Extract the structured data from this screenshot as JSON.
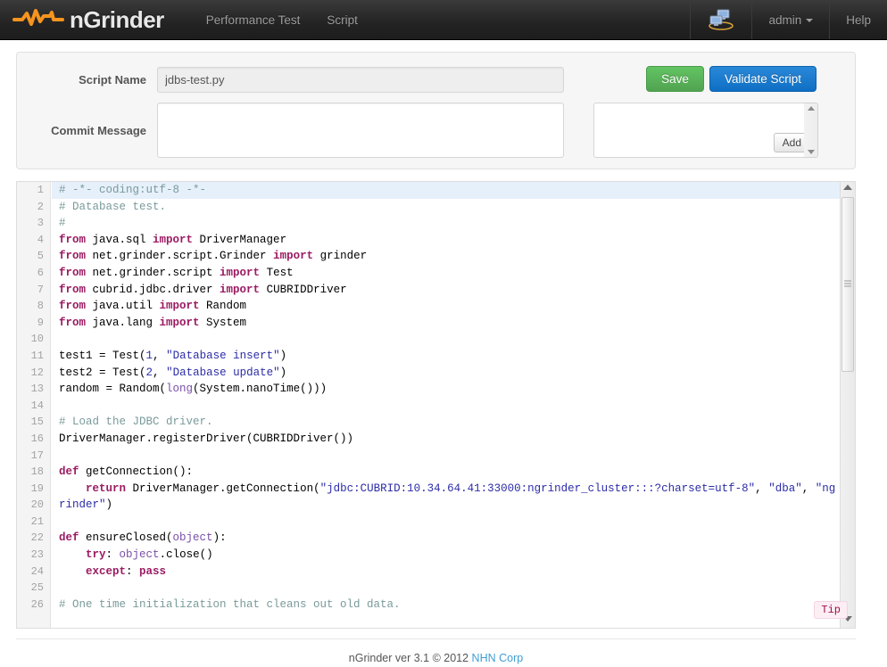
{
  "navbar": {
    "brand": {
      "text": "nGrinder",
      "logo_icon": "waveform-logo-icon",
      "accent_color": "#f7941e"
    },
    "links": [
      {
        "label": "Performance Test",
        "name": "nav-link-performance-test"
      },
      {
        "label": "Script",
        "name": "nav-link-script"
      }
    ],
    "switch_icon": "network-computers-icon",
    "user": {
      "label": "admin",
      "caret_icon": "caret-down-icon"
    },
    "help": {
      "label": "Help"
    }
  },
  "form": {
    "script_name": {
      "label": "Script Name",
      "value": "jdbs-test.py",
      "placeholder": ""
    },
    "commit_message": {
      "label": "Commit Message",
      "value": "",
      "placeholder": ""
    },
    "save_label": "Save",
    "validate_label": "Validate Script",
    "add_label": "Add"
  },
  "editor": {
    "active_line": 1,
    "tip_label": "Tip",
    "line_numbers": [
      1,
      2,
      3,
      4,
      5,
      6,
      7,
      8,
      9,
      10,
      11,
      12,
      13,
      14,
      15,
      16,
      17,
      18,
      19,
      20,
      21,
      22,
      23,
      24,
      25,
      26
    ],
    "lines": [
      {
        "n": 1,
        "active": true,
        "tokens": [
          {
            "t": "comment",
            "v": "# -*- coding:utf-8 -*-"
          }
        ]
      },
      {
        "n": 2,
        "tokens": [
          {
            "t": "comment",
            "v": "# Database test."
          }
        ]
      },
      {
        "n": 3,
        "tokens": [
          {
            "t": "comment",
            "v": "#"
          }
        ]
      },
      {
        "n": 4,
        "tokens": [
          {
            "t": "keyword",
            "v": "from"
          },
          {
            "t": "plain",
            "v": " java.sql "
          },
          {
            "t": "keyword",
            "v": "import"
          },
          {
            "t": "plain",
            "v": " DriverManager"
          }
        ]
      },
      {
        "n": 5,
        "tokens": [
          {
            "t": "keyword",
            "v": "from"
          },
          {
            "t": "plain",
            "v": " net.grinder.script.Grinder "
          },
          {
            "t": "keyword",
            "v": "import"
          },
          {
            "t": "plain",
            "v": " grinder"
          }
        ]
      },
      {
        "n": 6,
        "tokens": [
          {
            "t": "keyword",
            "v": "from"
          },
          {
            "t": "plain",
            "v": " net.grinder.script "
          },
          {
            "t": "keyword",
            "v": "import"
          },
          {
            "t": "plain",
            "v": " Test"
          }
        ]
      },
      {
        "n": 7,
        "tokens": [
          {
            "t": "keyword",
            "v": "from"
          },
          {
            "t": "plain",
            "v": " cubrid.jdbc.driver "
          },
          {
            "t": "keyword",
            "v": "import"
          },
          {
            "t": "plain",
            "v": " CUBRIDDriver"
          }
        ]
      },
      {
        "n": 8,
        "tokens": [
          {
            "t": "keyword",
            "v": "from"
          },
          {
            "t": "plain",
            "v": " java.util "
          },
          {
            "t": "keyword",
            "v": "import"
          },
          {
            "t": "plain",
            "v": " Random"
          }
        ]
      },
      {
        "n": 9,
        "tokens": [
          {
            "t": "keyword",
            "v": "from"
          },
          {
            "t": "plain",
            "v": " java.lang "
          },
          {
            "t": "keyword",
            "v": "import"
          },
          {
            "t": "plain",
            "v": " System"
          }
        ]
      },
      {
        "n": 10,
        "tokens": [
          {
            "t": "plain",
            "v": ""
          }
        ]
      },
      {
        "n": 11,
        "tokens": [
          {
            "t": "plain",
            "v": "test1 = Test("
          },
          {
            "t": "number",
            "v": "1"
          },
          {
            "t": "plain",
            "v": ", "
          },
          {
            "t": "string",
            "v": "\"Database insert\""
          },
          {
            "t": "plain",
            "v": ")"
          }
        ]
      },
      {
        "n": 12,
        "tokens": [
          {
            "t": "plain",
            "v": "test2 = Test("
          },
          {
            "t": "number",
            "v": "2"
          },
          {
            "t": "plain",
            "v": ", "
          },
          {
            "t": "string",
            "v": "\"Database update\""
          },
          {
            "t": "plain",
            "v": ")"
          }
        ]
      },
      {
        "n": 13,
        "tokens": [
          {
            "t": "plain",
            "v": "random = Random("
          },
          {
            "t": "builtin",
            "v": "long"
          },
          {
            "t": "plain",
            "v": "(System.nanoTime()))"
          }
        ]
      },
      {
        "n": 14,
        "tokens": [
          {
            "t": "plain",
            "v": ""
          }
        ]
      },
      {
        "n": 15,
        "tokens": [
          {
            "t": "comment",
            "v": "# Load the JDBC driver."
          }
        ]
      },
      {
        "n": 16,
        "tokens": [
          {
            "t": "plain",
            "v": "DriverManager.registerDriver(CUBRIDDriver())"
          }
        ]
      },
      {
        "n": 17,
        "tokens": [
          {
            "t": "plain",
            "v": ""
          }
        ]
      },
      {
        "n": 18,
        "tokens": [
          {
            "t": "keyword",
            "v": "def"
          },
          {
            "t": "plain",
            "v": " getConnection():"
          }
        ]
      },
      {
        "n": 19,
        "tokens": [
          {
            "t": "plain",
            "v": "    "
          },
          {
            "t": "keyword",
            "v": "return"
          },
          {
            "t": "plain",
            "v": " DriverManager.getConnection("
          },
          {
            "t": "string",
            "v": "\"jdbc:CUBRID:10.34.64.41:33000:ngrinder_cluster:::?charset=utf-8\""
          },
          {
            "t": "plain",
            "v": ", "
          },
          {
            "t": "string",
            "v": "\"dba\""
          },
          {
            "t": "plain",
            "v": ", "
          },
          {
            "t": "string",
            "v": "\"ngrinder\""
          },
          {
            "t": "plain",
            "v": ")"
          }
        ]
      },
      {
        "n": 20,
        "tokens": [
          {
            "t": "plain",
            "v": ""
          }
        ]
      },
      {
        "n": 21,
        "tokens": [
          {
            "t": "keyword",
            "v": "def"
          },
          {
            "t": "plain",
            "v": " ensureClosed("
          },
          {
            "t": "builtin",
            "v": "object"
          },
          {
            "t": "plain",
            "v": "):"
          }
        ]
      },
      {
        "n": 22,
        "tokens": [
          {
            "t": "plain",
            "v": "    "
          },
          {
            "t": "keyword",
            "v": "try"
          },
          {
            "t": "plain",
            "v": ": "
          },
          {
            "t": "builtin",
            "v": "object"
          },
          {
            "t": "plain",
            "v": ".close()"
          }
        ]
      },
      {
        "n": 23,
        "tokens": [
          {
            "t": "plain",
            "v": "    "
          },
          {
            "t": "keyword",
            "v": "except"
          },
          {
            "t": "plain",
            "v": ": "
          },
          {
            "t": "keyword",
            "v": "pass"
          }
        ]
      },
      {
        "n": 24,
        "tokens": [
          {
            "t": "plain",
            "v": ""
          }
        ]
      },
      {
        "n": 25,
        "tokens": [
          {
            "t": "comment",
            "v": "# One time initialization that cleans out old data."
          }
        ]
      },
      {
        "n": 26,
        "tokens": [
          {
            "t": "plain",
            "v": ""
          }
        ]
      }
    ]
  },
  "footer": {
    "text": "nGrinder ver 3.1 © 2012 ",
    "link_label": "NHN Corp"
  }
}
